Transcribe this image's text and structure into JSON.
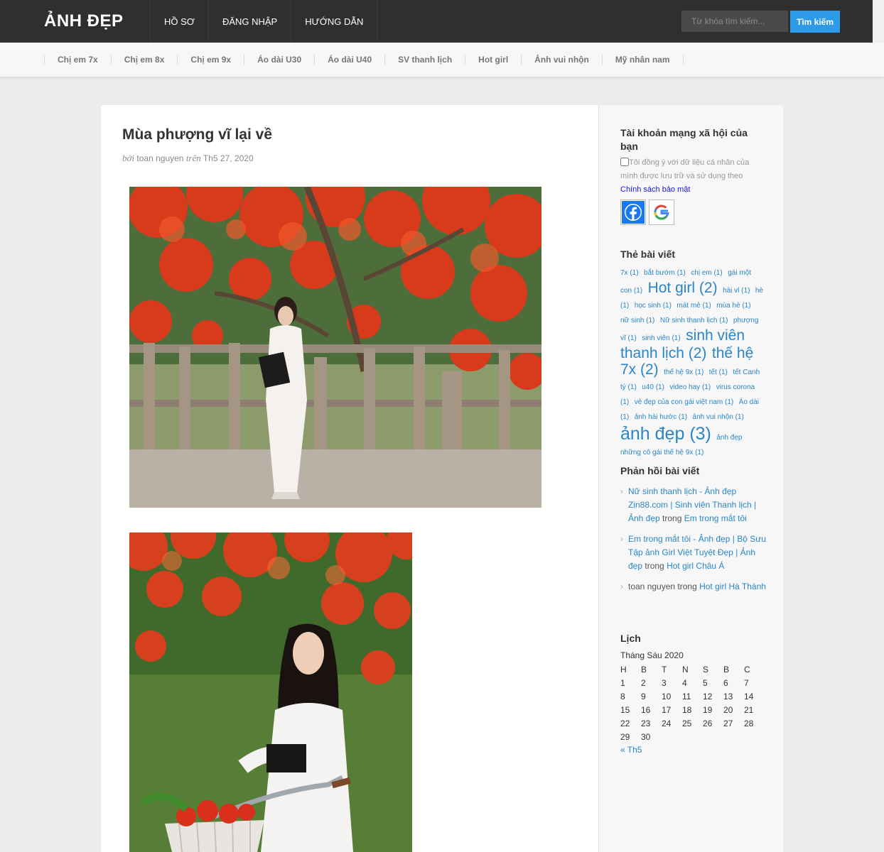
{
  "brand": "ẢNH ĐẸP",
  "topnav": [
    "HỒ SƠ",
    "ĐĂNG NHẬP",
    "HƯỚNG DẪN"
  ],
  "search": {
    "placeholder": "Từ khóa tìm kiếm...",
    "button": "Tìm kiếm"
  },
  "categories": [
    "Chị em 7x",
    "Chị em 8x",
    "Chị em 9x",
    "Áo dài U30",
    "Áo dài U40",
    "SV thanh lịch",
    "Hot girl",
    "Ảnh vui nhộn",
    "Mỹ nhân nam"
  ],
  "post": {
    "title": "Mùa phượng vĩ lại về",
    "meta_by": "bởi",
    "author": "toan nguyen",
    "meta_on": "trên",
    "date": "Th5 27, 2020"
  },
  "sidebar": {
    "social_title": "Tài khoản mạng xã hội của bạn",
    "consent_text": "Tôi đồng ý với dữ liệu cá nhân của mình được lưu trữ và sử dụng theo",
    "policy_link": "Chính sách bảo mật",
    "tags_title": "Thẻ bài viết",
    "tags": [
      {
        "text": "7x (1)",
        "size": "s"
      },
      {
        "text": "bắt bướm (1)",
        "size": "s"
      },
      {
        "text": "chị em (1)",
        "size": "s"
      },
      {
        "text": "gái một con (1)",
        "size": "s"
      },
      {
        "text": "Hot girl (2)",
        "size": "m"
      },
      {
        "text": "hài vl (1)",
        "size": "s"
      },
      {
        "text": "hè (1)",
        "size": "s"
      },
      {
        "text": "học sinh (1)",
        "size": "s"
      },
      {
        "text": "mát mẻ (1)",
        "size": "s"
      },
      {
        "text": "mùa hè (1)",
        "size": "s"
      },
      {
        "text": "nữ sinh (1)",
        "size": "s"
      },
      {
        "text": "Nữ sinh thanh lịch (1)",
        "size": "s"
      },
      {
        "text": "phượng vĩ (1)",
        "size": "s"
      },
      {
        "text": "sinh viên (1)",
        "size": "s"
      },
      {
        "text": "sinh viên thanh lịch (2)",
        "size": "m"
      },
      {
        "text": "thế hệ 7x (2)",
        "size": "m"
      },
      {
        "text": "thế hệ 9x (1)",
        "size": "s"
      },
      {
        "text": "tết (1)",
        "size": "s"
      },
      {
        "text": "tết Canh tý (1)",
        "size": "s"
      },
      {
        "text": "u40 (1)",
        "size": "s"
      },
      {
        "text": "video hay (1)",
        "size": "s"
      },
      {
        "text": "virus corona (1)",
        "size": "s"
      },
      {
        "text": "vẻ đẹp của con gái việt nam (1)",
        "size": "s"
      },
      {
        "text": "Áo dài (1)",
        "size": "s"
      },
      {
        "text": "ảnh hài hước (1)",
        "size": "s"
      },
      {
        "text": "ảnh vui nhộn (1)",
        "size": "s"
      },
      {
        "text": "ảnh đẹp (3)",
        "size": "l"
      },
      {
        "text": "ảnh đẹp những cô gái thế hệ 9x (1)",
        "size": "s"
      }
    ],
    "comments_title": "Phản hồi bài viết",
    "comments": [
      {
        "author": "Nữ sinh thanh lịch - Ảnh đẹp Zin88.com | Sinh viên Thanh lịch | Ảnh đẹp",
        "author_link": true,
        "in": "trong",
        "post": "Em trong mắt tôi"
      },
      {
        "author": "Em trong mắt tôi - Ảnh đẹp | Bộ Sưu Tập ảnh Girl Việt Tuyệt Đẹp | Ảnh đẹp",
        "author_link": true,
        "in": "trong",
        "post": "Hot girl Châu Á"
      },
      {
        "author": "toan nguyen",
        "author_link": false,
        "in": "trong",
        "post": "Hot girl Hà Thành"
      }
    ],
    "calendar_title": "Lịch",
    "calendar_caption": "Tháng Sáu 2020",
    "calendar_days": [
      "H",
      "B",
      "T",
      "N",
      "S",
      "B",
      "C"
    ],
    "calendar_weeks": [
      [
        "1",
        "2",
        "3",
        "4",
        "5",
        "6",
        "7"
      ],
      [
        "8",
        "9",
        "10",
        "11",
        "12",
        "13",
        "14"
      ],
      [
        "15",
        "16",
        "17",
        "18",
        "19",
        "20",
        "21"
      ],
      [
        "22",
        "23",
        "24",
        "25",
        "26",
        "27",
        "28"
      ],
      [
        "29",
        "30",
        "",
        "",
        "",
        "",
        ""
      ]
    ],
    "calendar_prev": "« Th5"
  },
  "colors": {
    "topbar": "#2f2f2f",
    "accent": "#2e9be8",
    "link": "#2a86c8"
  }
}
